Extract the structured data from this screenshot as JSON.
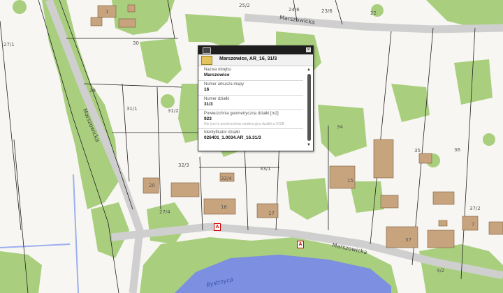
{
  "map": {
    "roads": [
      "Marszowicka",
      "Marszowicka",
      "Marszowicka",
      "Marszowicka"
    ],
    "water": "Bystrzyca",
    "parcels": [
      "25/2",
      "24/6",
      "23/6",
      "22",
      "27/1",
      "29",
      "30",
      "31/1",
      "31/2",
      "32/3",
      "32/4",
      "33/1",
      "34",
      "35",
      "36",
      "37/2",
      "27/4",
      "4/2"
    ],
    "buildings": [
      "1",
      "15",
      "20",
      "16",
      "17",
      "37",
      "7"
    ],
    "markers": [
      "A",
      "A"
    ]
  },
  "popup": {
    "title": "Marszowice, AR_16, 31/3",
    "close_label": "×",
    "fields": [
      {
        "label": "Nazwa obrębu",
        "value": "Marszowice"
      },
      {
        "label": "Numer arkusza mapy",
        "value": "16"
      },
      {
        "label": "Numer działki",
        "value": "31/3"
      },
      {
        "label": "Powierzchnia geometryczna działki [m2]",
        "value": "923",
        "note": "Nie jest to powierzchnia ewidencyjna działki w EGiB"
      },
      {
        "label": "Identyfikator działki",
        "value": "026401_1.0034.AR_16.31/3"
      }
    ]
  },
  "colors": {
    "vegetation": "#a9cf7e",
    "building": "#c7a47e",
    "water": "#7d8fe0",
    "background": "#f7f6f2",
    "road": "#d5d5d5"
  }
}
